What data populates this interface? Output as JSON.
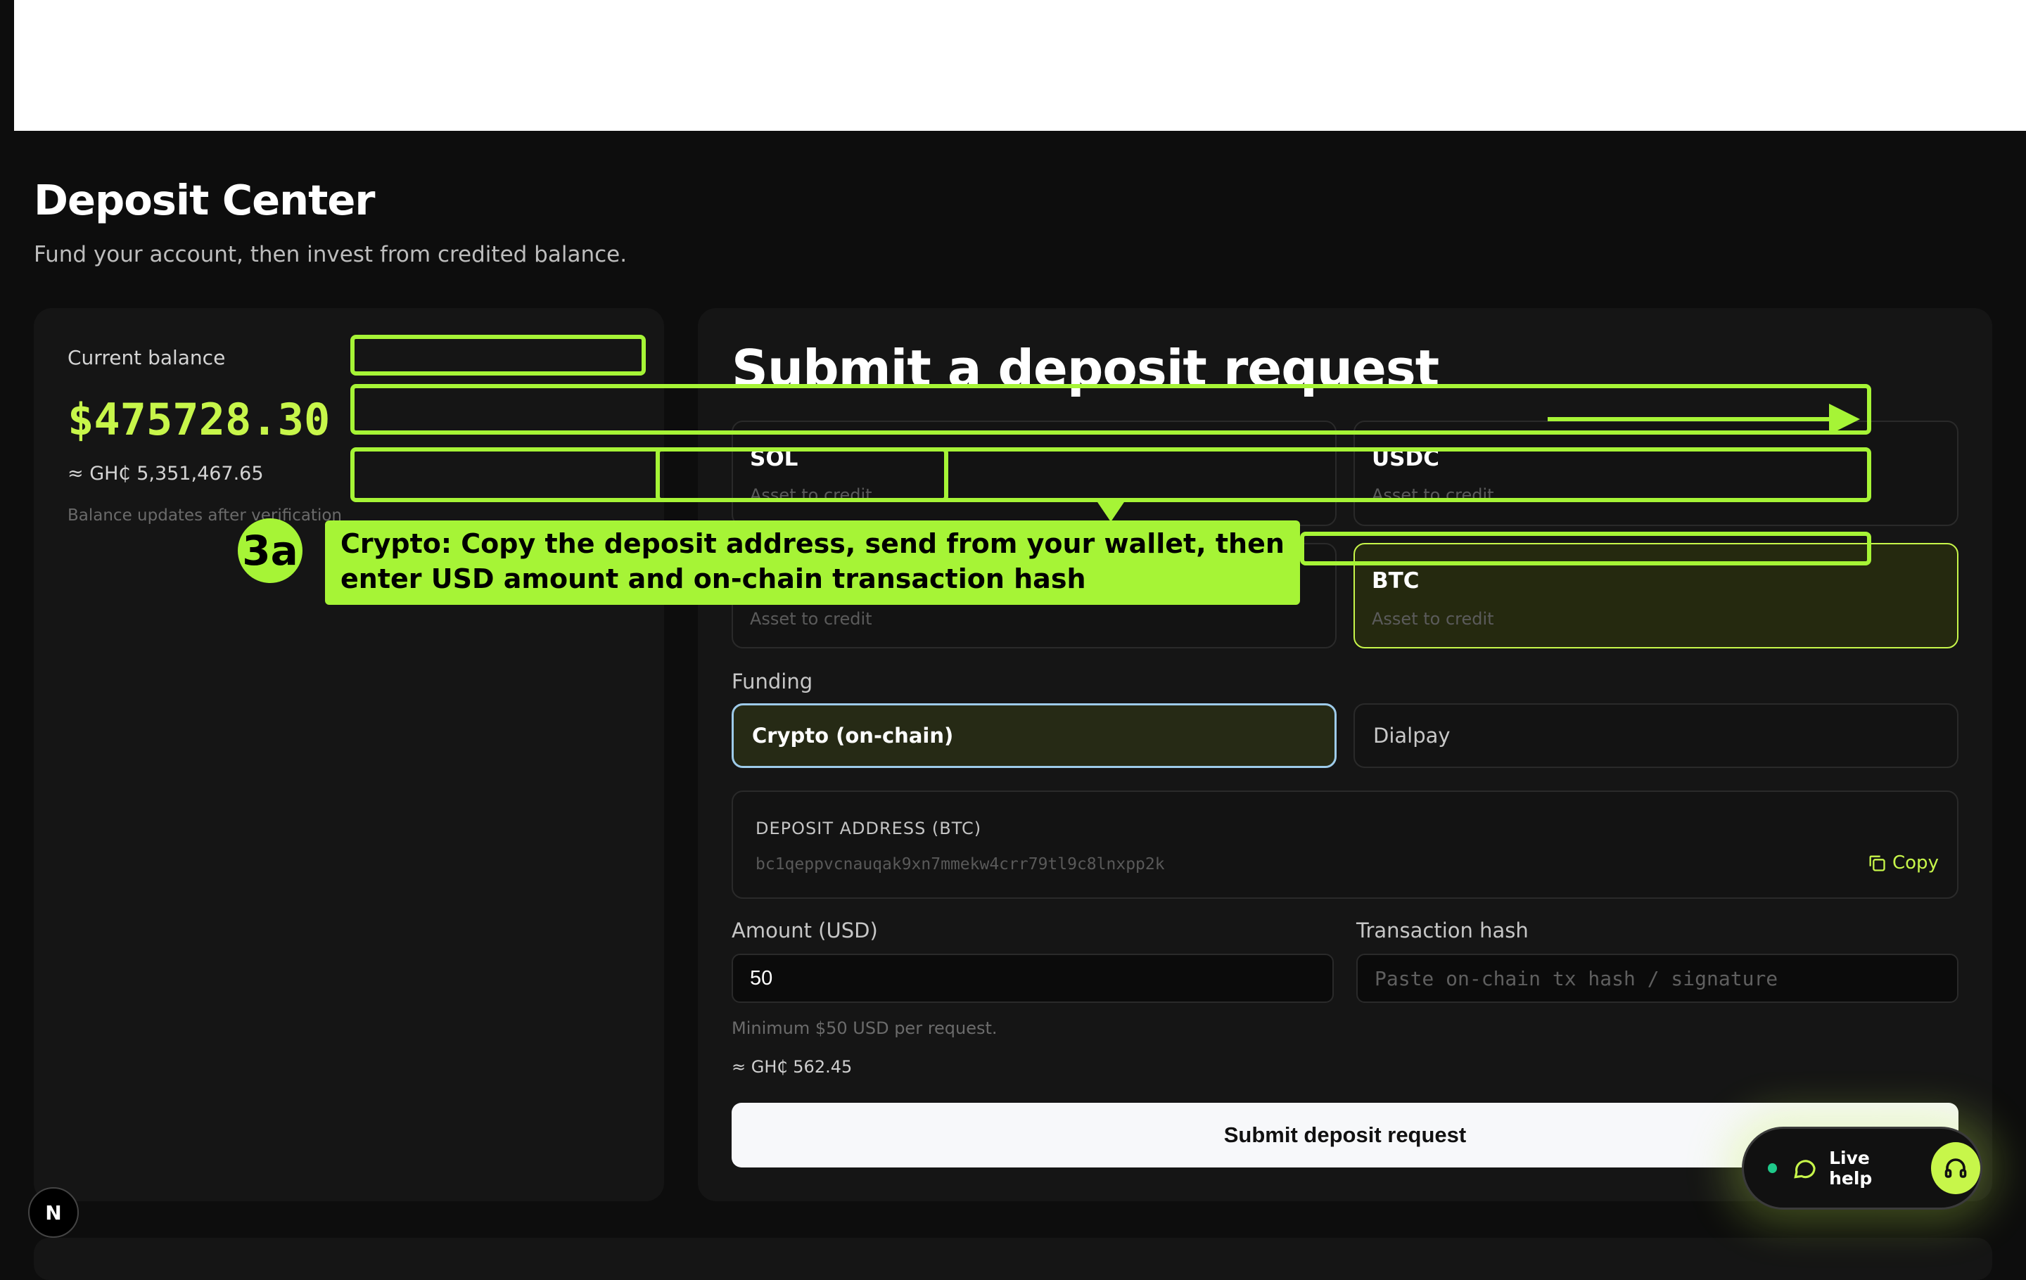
{
  "page": {
    "title": "Deposit Center",
    "subtitle": "Fund your account, then invest from credited balance."
  },
  "balance": {
    "label": "Current balance",
    "value": "$475728.30",
    "ghs": "≈ GH₵ 5,351,467.65",
    "note": "Balance updates after verification"
  },
  "form": {
    "title": "Submit a deposit request",
    "assets": [
      {
        "name": "SOL",
        "sub": "Asset to credit"
      },
      {
        "name": "USDC",
        "sub": "Asset to credit"
      },
      {
        "name": "",
        "sub": "Asset to credit"
      },
      {
        "name": "BTC",
        "sub": "Asset to credit",
        "selected": true
      }
    ],
    "funding_label": "Funding",
    "funding_options": [
      "Crypto (on-chain)",
      "Dialpay"
    ],
    "deposit_address_label": "DEPOSIT ADDRESS (BTC)",
    "deposit_address": "bc1qeppvcnauqak9xn7mmekw4crr79tl9c8lnxpp2k",
    "copy_label": "Copy",
    "amount_label": "Amount (USD)",
    "amount_value": "50",
    "tx_label": "Transaction hash",
    "tx_placeholder": "Paste on-chain tx hash / signature",
    "min_note": "Minimum $50 USD per request.",
    "conversion": "≈ GH₵ 562.45",
    "submit_label": "Submit deposit request"
  },
  "live_help": {
    "label": "Live help"
  },
  "badge": {
    "letter": "N"
  },
  "overlay": {
    "step": "3a",
    "text": "Crypto: Copy the deposit address, send from your wallet, then enter USD amount and on-chain transaction hash"
  },
  "colors": {
    "accent": "#c7f64a",
    "overlay": "#a6f436",
    "background": "#0d0d0d",
    "card": "#151515"
  }
}
